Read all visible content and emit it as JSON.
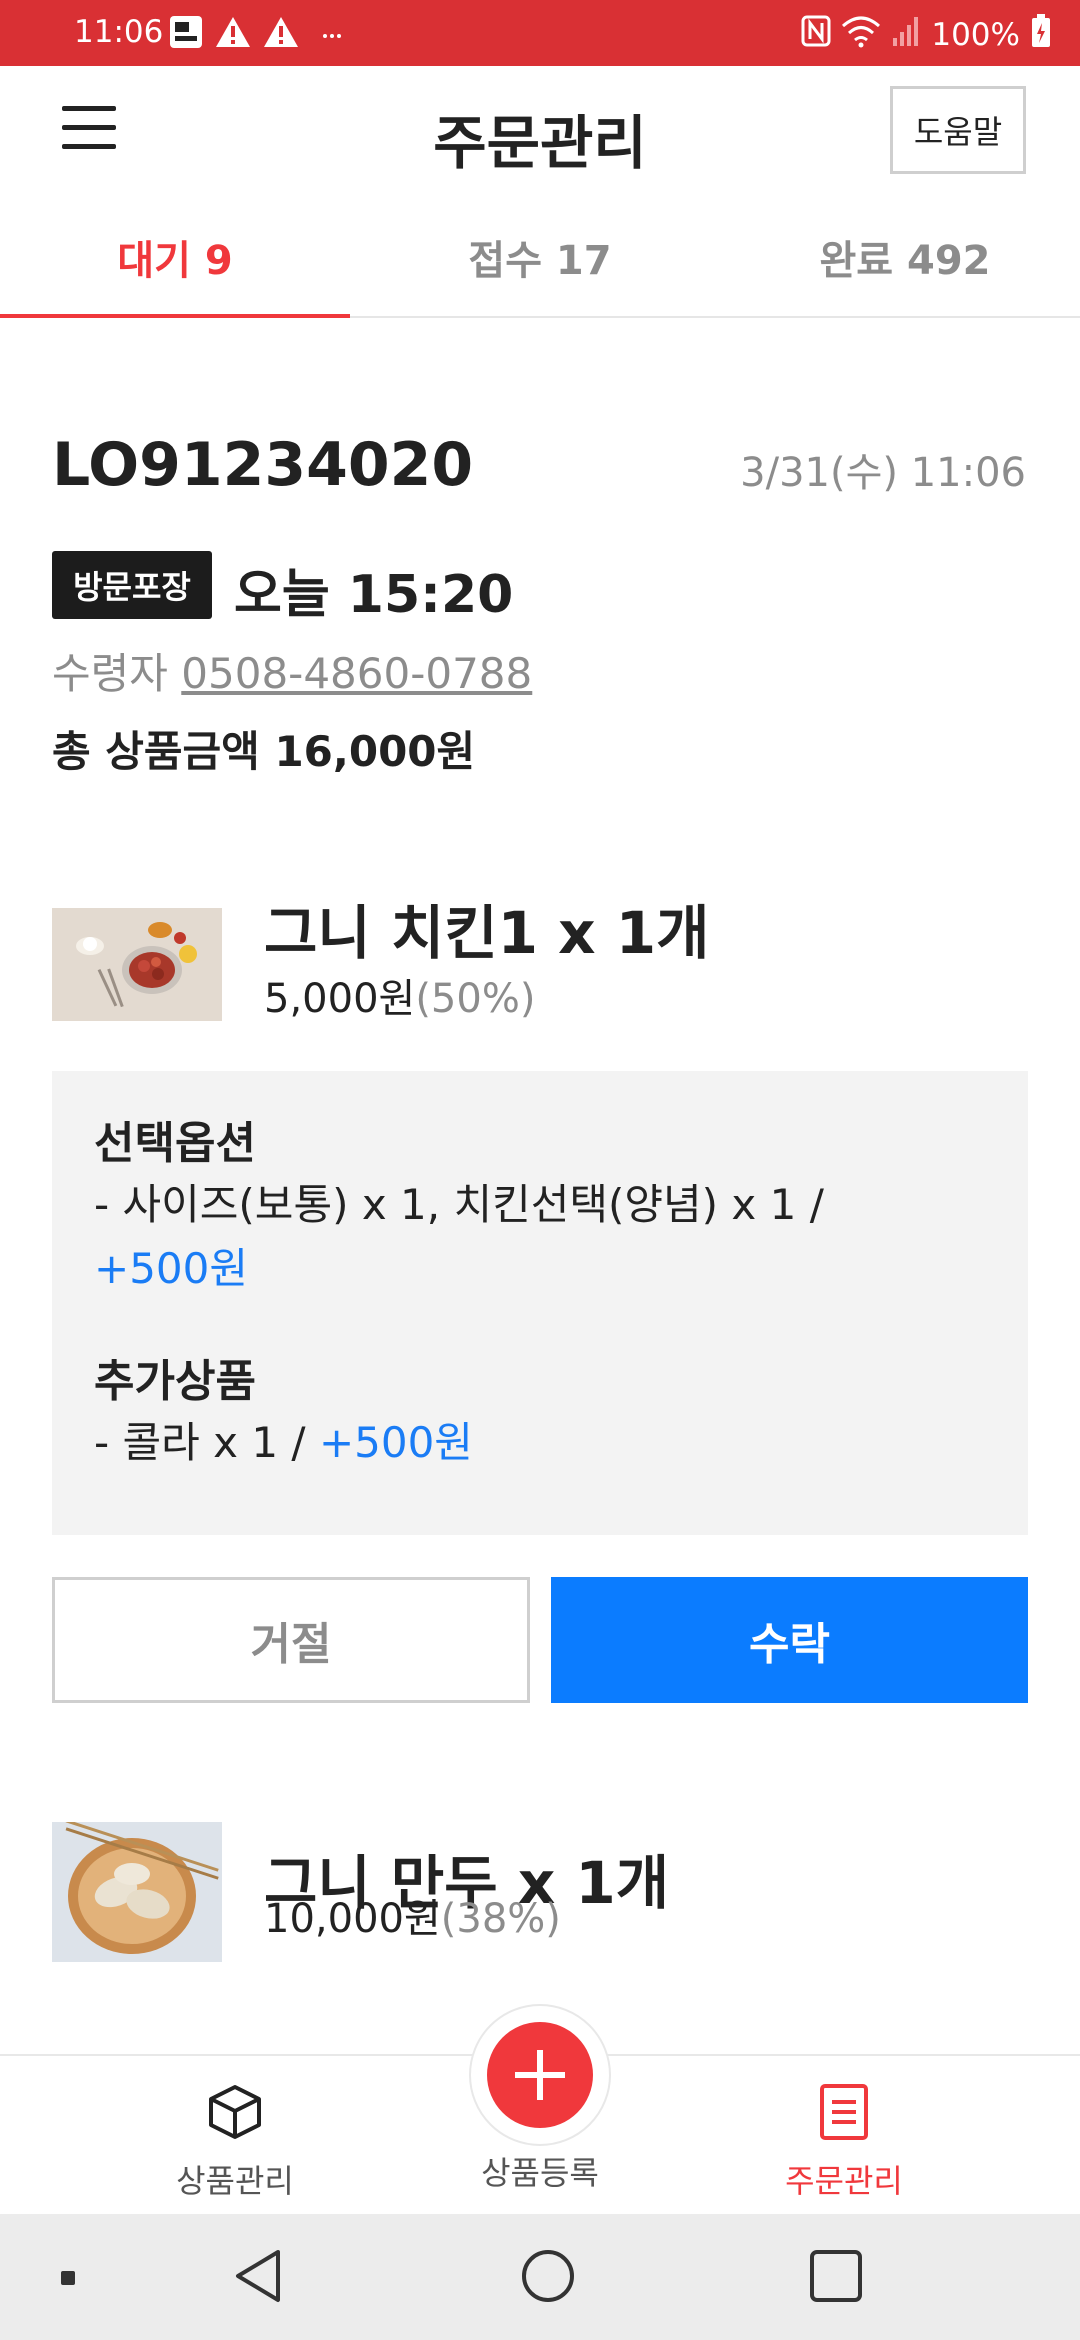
{
  "status_bar": {
    "time": "11:06",
    "battery": "100%",
    "icons": [
      "app-notification-icon",
      "warning-icon",
      "warning-icon",
      "more-icon",
      "nfc-icon",
      "wifi-icon",
      "signal-icon",
      "battery-icon"
    ]
  },
  "header": {
    "title": "주문관리",
    "help_label": "도움말",
    "menu_icon": "hamburger-menu-icon"
  },
  "tabs": [
    {
      "label": "대기 9",
      "active": true
    },
    {
      "label": "접수 17",
      "active": false
    },
    {
      "label": "완료 492",
      "active": false
    }
  ],
  "order": {
    "id": "LO91234020",
    "date": "3/31(수) 11:06",
    "type_badge": "방문포장",
    "pickup_time": "오늘 15:20",
    "recipient_label": "수령자",
    "recipient_phone": "0508-4860-0788",
    "total": "총 상품금액 16,000원"
  },
  "products": [
    {
      "name": "그니 치킨1 x 1개",
      "price": "5,000원",
      "discount": "(50%)",
      "options_title": "선택옵션",
      "options_line": "- 사이즈(보통) x 1, 치킨선택(양념) x 1 /",
      "options_extra": "+500원",
      "addons_title": "추가상품",
      "addons_line": "- 콜라 x 1 /",
      "addons_extra": "+500원"
    },
    {
      "name": "그니 만두 x 1개",
      "price": "10,000원",
      "discount": "(38%)"
    }
  ],
  "actions": {
    "reject": "거절",
    "accept": "수락"
  },
  "bottom_nav": {
    "items": [
      {
        "label": "상품관리",
        "icon": "box-icon",
        "active": false
      },
      {
        "label": "상품등록",
        "icon": "plus-icon",
        "active": false
      },
      {
        "label": "주문관리",
        "icon": "order-list-icon",
        "active": true
      }
    ]
  },
  "colors": {
    "status_bar": "#d93034",
    "accent_red": "#f0383c",
    "accent_blue": "#0b7cff",
    "price_blue": "#1a7cf5"
  }
}
